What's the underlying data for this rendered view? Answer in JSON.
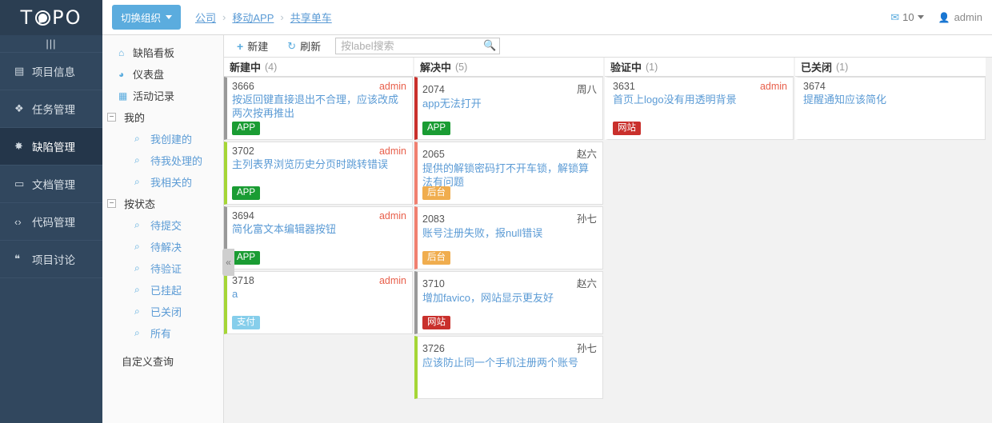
{
  "brand": {
    "logo_text_left": "T",
    "logo_text_right": "PO"
  },
  "topbar": {
    "org_button": "切换组织",
    "breadcrumb": [
      "公司",
      "移动APP",
      "共享单车"
    ],
    "breadcrumb_sep": "›",
    "mail_count": "10",
    "mail_icon": "envelope-icon",
    "user_name": "admin",
    "user_icon": "person-icon"
  },
  "rail": {
    "collapse_glyph": "|||",
    "items": [
      {
        "label": "项目信息",
        "icon": "document-icon",
        "glyph": "▤",
        "active": false
      },
      {
        "label": "任务管理",
        "icon": "tasks-icon",
        "glyph": "❖",
        "active": false
      },
      {
        "label": "缺陷管理",
        "icon": "bug-icon",
        "glyph": "✸",
        "active": true
      },
      {
        "label": "文档管理",
        "icon": "folder-icon",
        "glyph": "▭",
        "active": false
      },
      {
        "label": "代码管理",
        "icon": "code-icon",
        "glyph": "‹›",
        "active": false
      },
      {
        "label": "项目讨论",
        "icon": "chat-icon",
        "glyph": "❝",
        "active": false
      }
    ]
  },
  "submenu": {
    "top_items": [
      {
        "label": "缺陷看板",
        "icon": "home-icon",
        "glyph": "⌂"
      },
      {
        "label": "仪表盘",
        "icon": "dashboard-icon",
        "glyph": "◕"
      },
      {
        "label": "活动记录",
        "icon": "activity-icon",
        "glyph": "▦"
      }
    ],
    "groups": [
      {
        "label": "我的",
        "toggle": "−",
        "children": [
          {
            "label": "我创建的",
            "icon": "search-icon",
            "glyph": "⌕"
          },
          {
            "label": "待我处理的",
            "icon": "search-icon",
            "glyph": "⌕"
          },
          {
            "label": "我相关的",
            "icon": "search-icon",
            "glyph": "⌕"
          }
        ]
      },
      {
        "label": "按状态",
        "toggle": "−",
        "children": [
          {
            "label": "待提交",
            "icon": "search-icon",
            "glyph": "⌕"
          },
          {
            "label": "待解决",
            "icon": "search-icon",
            "glyph": "⌕"
          },
          {
            "label": "待验证",
            "icon": "search-icon",
            "glyph": "⌕"
          },
          {
            "label": "已挂起",
            "icon": "search-icon",
            "glyph": "⌕"
          },
          {
            "label": "已关闭",
            "icon": "search-icon",
            "glyph": "⌕"
          },
          {
            "label": "所有",
            "icon": "search-icon",
            "glyph": "⌕"
          }
        ]
      }
    ],
    "custom_query": "自定义查询",
    "collapse_handle_glyph": "«"
  },
  "toolbar": {
    "new_label": "新建",
    "new_icon": "plus-icon",
    "refresh_label": "刷新",
    "refresh_icon": "refresh-icon",
    "search_placeholder": "按label搜索",
    "search_value": "",
    "search_icon": "search-icon"
  },
  "board": {
    "columns": [
      {
        "title": "新建中",
        "count": "(4)",
        "cards": [
          {
            "id": "3666",
            "user": "admin",
            "user_color": "red",
            "title": "按返回键直接退出不合理，应该改成两次按再推出",
            "accent": "#999999",
            "tags": [
              {
                "text": "APP",
                "color": "#1a9c33"
              }
            ]
          },
          {
            "id": "3702",
            "user": "admin",
            "user_color": "red",
            "title": "主列表界浏览历史分页时跳转错误",
            "accent": "#a5d636",
            "tags": [
              {
                "text": "APP",
                "color": "#1a9c33"
              }
            ]
          },
          {
            "id": "3694",
            "user": "admin",
            "user_color": "red",
            "title": "简化富文本编辑器按钮",
            "accent": "#999999",
            "tags": [
              {
                "text": "APP",
                "color": "#1a9c33"
              }
            ]
          },
          {
            "id": "3718",
            "user": "admin",
            "user_color": "red",
            "title": "a",
            "accent": "#a5d636",
            "tags": [
              {
                "text": "支付",
                "color": "#86ceeb"
              }
            ]
          }
        ]
      },
      {
        "title": "解决中",
        "count": "(5)",
        "cards": [
          {
            "id": "2074",
            "user": "周八",
            "user_color": "gray",
            "title": "app无法打开",
            "accent": "#c9302c",
            "tags": [
              {
                "text": "APP",
                "color": "#1a9c33"
              }
            ]
          },
          {
            "id": "2065",
            "user": "赵六",
            "user_color": "gray",
            "title": "提供的解锁密码打不开车锁，解锁算法有问题",
            "accent": "#f08070",
            "tags": [
              {
                "text": "后台",
                "color": "#f0ad4e"
              }
            ]
          },
          {
            "id": "2083",
            "user": "孙七",
            "user_color": "gray",
            "title": "账号注册失败，报null错误",
            "accent": "#f08070",
            "tags": [
              {
                "text": "后台",
                "color": "#f0ad4e"
              }
            ]
          },
          {
            "id": "3710",
            "user": "赵六",
            "user_color": "gray",
            "title": "增加favico，网站显示更友好",
            "accent": "#999999",
            "tags": [
              {
                "text": "网站",
                "color": "#c9302c"
              }
            ]
          },
          {
            "id": "3726",
            "user": "孙七",
            "user_color": "gray",
            "title": "应该防止同一个手机注册两个账号",
            "accent": "#a5d636",
            "tags": []
          }
        ]
      },
      {
        "title": "验证中",
        "count": "(1)",
        "cards": [
          {
            "id": "3631",
            "user": "admin",
            "user_color": "red",
            "title": "首页上logo没有用透明背景",
            "accent": "#ffffff",
            "tags": [
              {
                "text": "网站",
                "color": "#c9302c"
              }
            ]
          }
        ]
      },
      {
        "title": "已关闭",
        "count": "(1)",
        "cards": [
          {
            "id": "3674",
            "user": "",
            "user_color": "gray",
            "title": "提醒通知应该简化",
            "accent": "#ffffff",
            "tags": []
          }
        ]
      }
    ]
  },
  "colors": {
    "brand_dark": "#31475e",
    "accent_blue": "#5bacde",
    "link_blue": "#5b9bd5",
    "board_bg": "#f2f2f2"
  }
}
